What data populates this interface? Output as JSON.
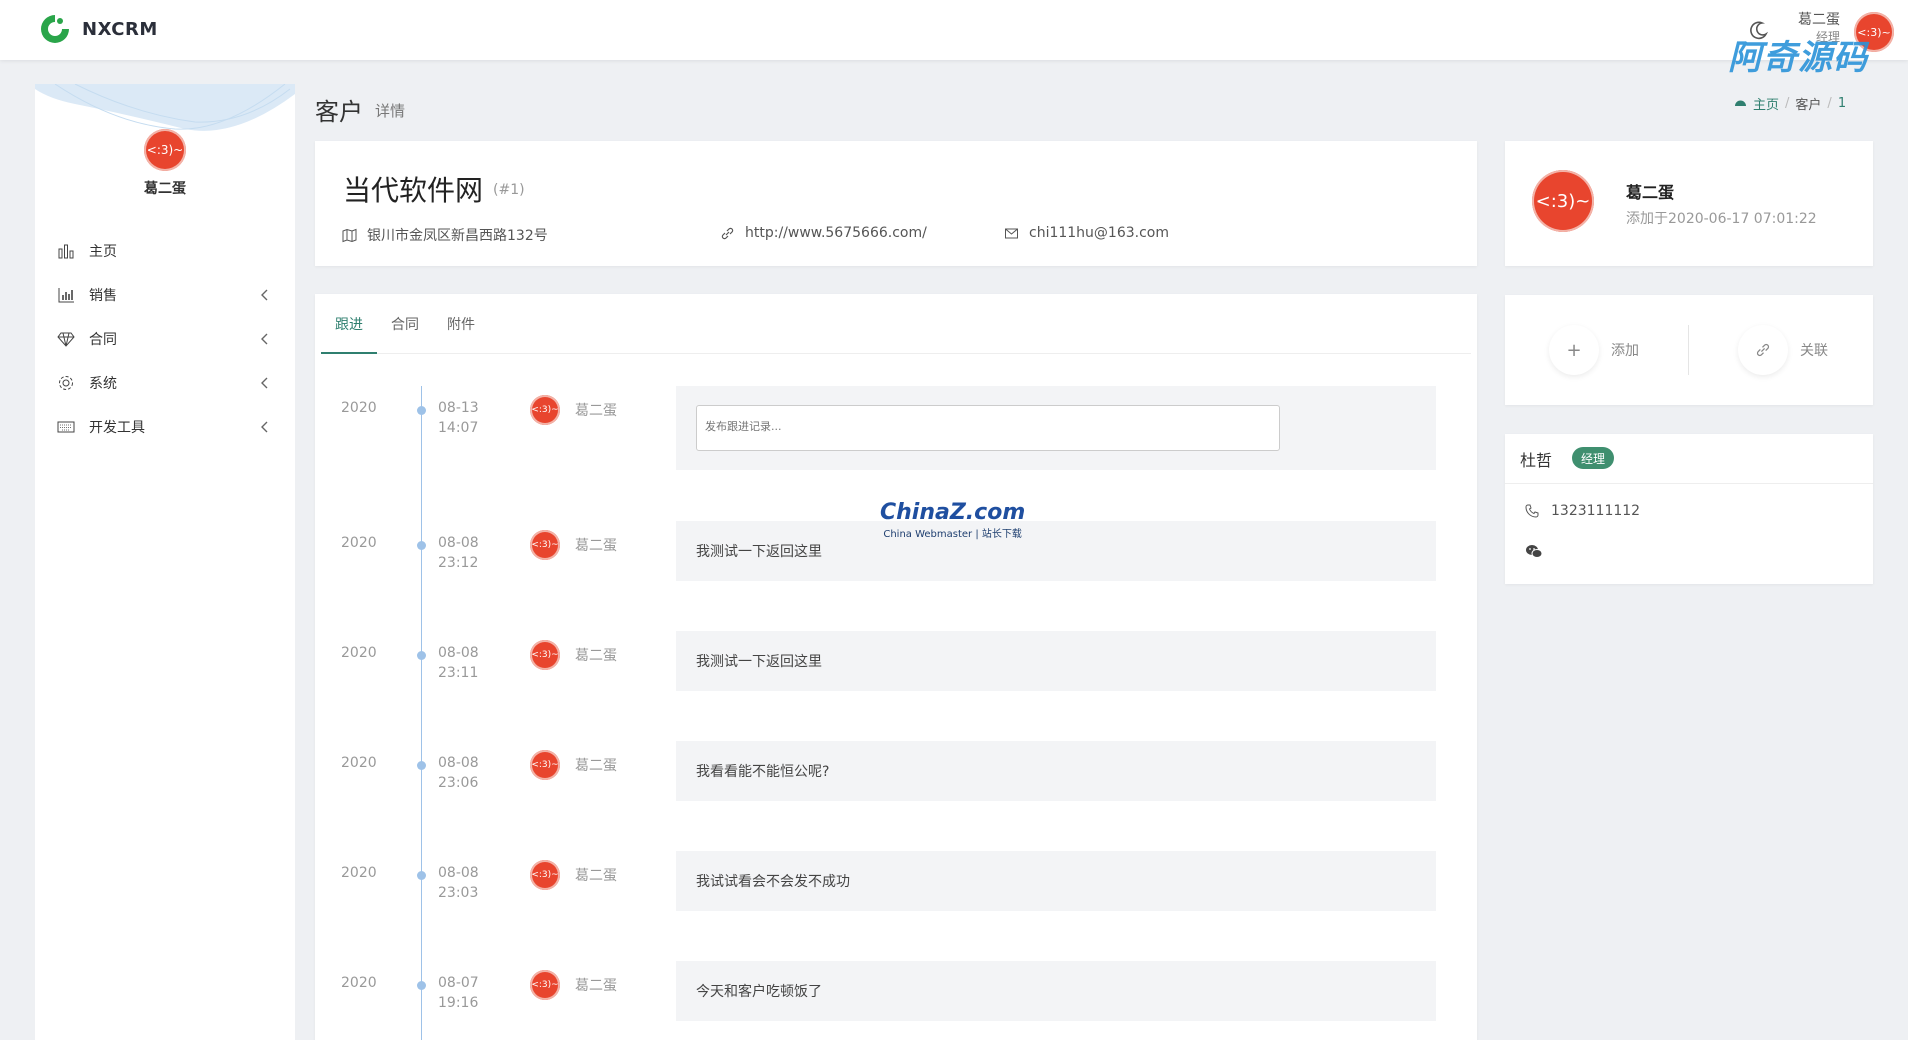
{
  "app": {
    "name": "NXCRM"
  },
  "topbar": {
    "user_name": "葛二蛋",
    "user_role": "经理",
    "avatar_text": "<:3)~",
    "watermark": "阿奇源码"
  },
  "sidebar": {
    "avatar_text": "<:3)~",
    "user_name": "葛二蛋",
    "items": [
      {
        "label": "主页",
        "icon": "bar-chart-icon",
        "has_chevron": false
      },
      {
        "label": "销售",
        "icon": "column-chart-icon",
        "has_chevron": true
      },
      {
        "label": "合同",
        "icon": "diamond-icon",
        "has_chevron": true
      },
      {
        "label": "系统",
        "icon": "gear-icon",
        "has_chevron": true
      },
      {
        "label": "开发工具",
        "icon": "keyboard-icon",
        "has_chevron": true
      }
    ]
  },
  "page": {
    "title": "客户",
    "subtitle": "详情"
  },
  "breadcrumb": {
    "home": "主页",
    "section": "客户",
    "current": "1"
  },
  "customer": {
    "name": "当代软件网",
    "id": "(#1)",
    "address": "银川市金凤区新昌西路132号",
    "website": "http://www.5675666.com/",
    "email": "chi111hu@163.com"
  },
  "tabs": [
    {
      "label": "跟进",
      "active": true
    },
    {
      "label": "合同",
      "active": false
    },
    {
      "label": "附件",
      "active": false
    }
  ],
  "timeline": {
    "input_placeholder": "发布跟进记录...",
    "entries": [
      {
        "year": "2020",
        "date": "08-13",
        "time": "14:07",
        "avatar_text": "<:3)~",
        "user": "葛二蛋",
        "content": ""
      },
      {
        "year": "2020",
        "date": "08-08",
        "time": "23:12",
        "avatar_text": "<:3)~",
        "user": "葛二蛋",
        "content": "我测试一下返回这里"
      },
      {
        "year": "2020",
        "date": "08-08",
        "time": "23:11",
        "avatar_text": "<:3)~",
        "user": "葛二蛋",
        "content": "我测试一下返回这里"
      },
      {
        "year": "2020",
        "date": "08-08",
        "time": "23:06",
        "avatar_text": "<:3)~",
        "user": "葛二蛋",
        "content": "我看看能不能恒公呢?"
      },
      {
        "year": "2020",
        "date": "08-08",
        "time": "23:03",
        "avatar_text": "<:3)~",
        "user": "葛二蛋",
        "content": "我试试看会不会发不成功"
      },
      {
        "year": "2020",
        "date": "08-07",
        "time": "19:16",
        "avatar_text": "<:3)~",
        "user": "葛二蛋",
        "content": "今天和客户吃顿饭了"
      }
    ]
  },
  "watermark": {
    "main": "ChinaZ.com",
    "sub": "China Webmaster | 站长下载"
  },
  "owner": {
    "avatar_text": "<:3)~",
    "name": "葛二蛋",
    "added": "添加于2020-06-17 07:01:22"
  },
  "actions": {
    "add": "添加",
    "link": "关联"
  },
  "contact": {
    "name": "杜哲",
    "badge": "经理",
    "phone": "1323111112"
  },
  "colors": {
    "accent": "#2f7f6f",
    "avatar": "#e8452e",
    "badge": "#3f8f6f",
    "timeline": "#9ec2e8"
  }
}
